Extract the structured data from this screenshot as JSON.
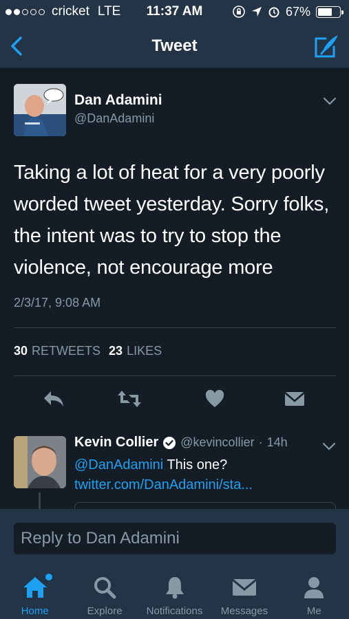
{
  "status_bar": {
    "carrier": "cricket",
    "network": "LTE",
    "time": "11:37 AM",
    "battery": "67%",
    "battery_level": 0.67
  },
  "nav": {
    "title": "Tweet",
    "back_icon": "chevron-left-icon",
    "compose_icon": "compose-icon"
  },
  "tweet": {
    "author_name": "Dan Adamini",
    "author_handle": "@DanAdamini",
    "text": "Taking a lot of heat for a very poorly worded tweet yesterday. Sorry folks, the intent was to try to stop the violence, not encourage more",
    "timestamp": "2/3/17, 9:08 AM",
    "retweets_count": "30",
    "retweets_label": "RETWEETS",
    "likes_count": "23",
    "likes_label": "LIKES"
  },
  "reply": {
    "name": "Kevin Collier",
    "handle": "@kevincollier",
    "separator": "·",
    "time": "14h",
    "mention": "@DanAdamini",
    "text": " This one?",
    "link": "twitter.com/DanAdamini/sta..."
  },
  "reply_bar": {
    "placeholder": "Reply to Dan Adamini"
  },
  "tabs": [
    {
      "label": "Home",
      "icon": "home-icon",
      "active": true
    },
    {
      "label": "Explore",
      "icon": "search-icon",
      "active": false
    },
    {
      "label": "Notifications",
      "icon": "bell-icon",
      "active": false
    },
    {
      "label": "Messages",
      "icon": "envelope-icon",
      "active": false
    },
    {
      "label": "Me",
      "icon": "person-icon",
      "active": false
    }
  ],
  "colors": {
    "accent": "#1da1f2",
    "background": "#141d26",
    "bar": "#243447",
    "muted": "#8899a6"
  }
}
